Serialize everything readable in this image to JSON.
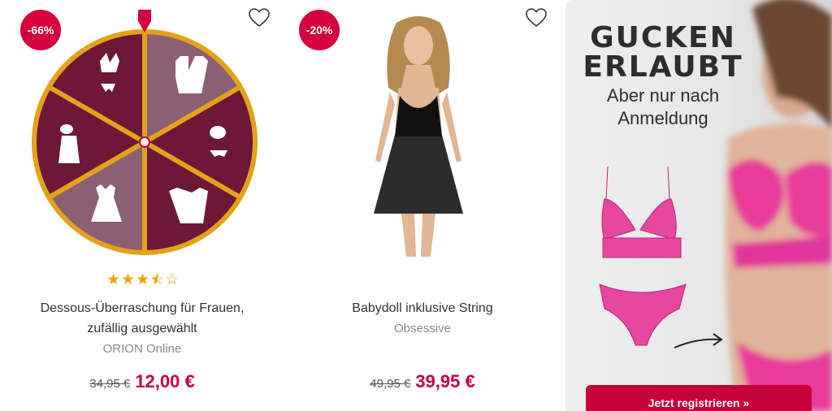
{
  "products": [
    {
      "discount_badge": "-66%",
      "rating": 3.5,
      "title_line1": "Dessous-Überraschung für Frauen,",
      "title_line2": "zufällig ausgewählt",
      "brand": "ORION Online",
      "old_price": "34,95 €",
      "new_price": "12,00 €"
    },
    {
      "discount_badge": "-20%",
      "title": "Babydoll inklusive String",
      "brand": "Obsessive",
      "old_price": "49,95 €",
      "new_price": "39,95 €"
    }
  ],
  "banner": {
    "headline_1": "GUCKEN",
    "headline_2": "ERLAUBT",
    "subline_1": "Aber nur nach",
    "subline_2": "Anmeldung",
    "cta_label": "Jetzt registrieren »"
  },
  "colors": {
    "accent": "#c8003a",
    "badge": "#d6003c",
    "wheel_dark": "#6e1838",
    "wheel_light": "#8c6074",
    "wheel_rim": "#e3a21a",
    "star": "#e8a800"
  }
}
